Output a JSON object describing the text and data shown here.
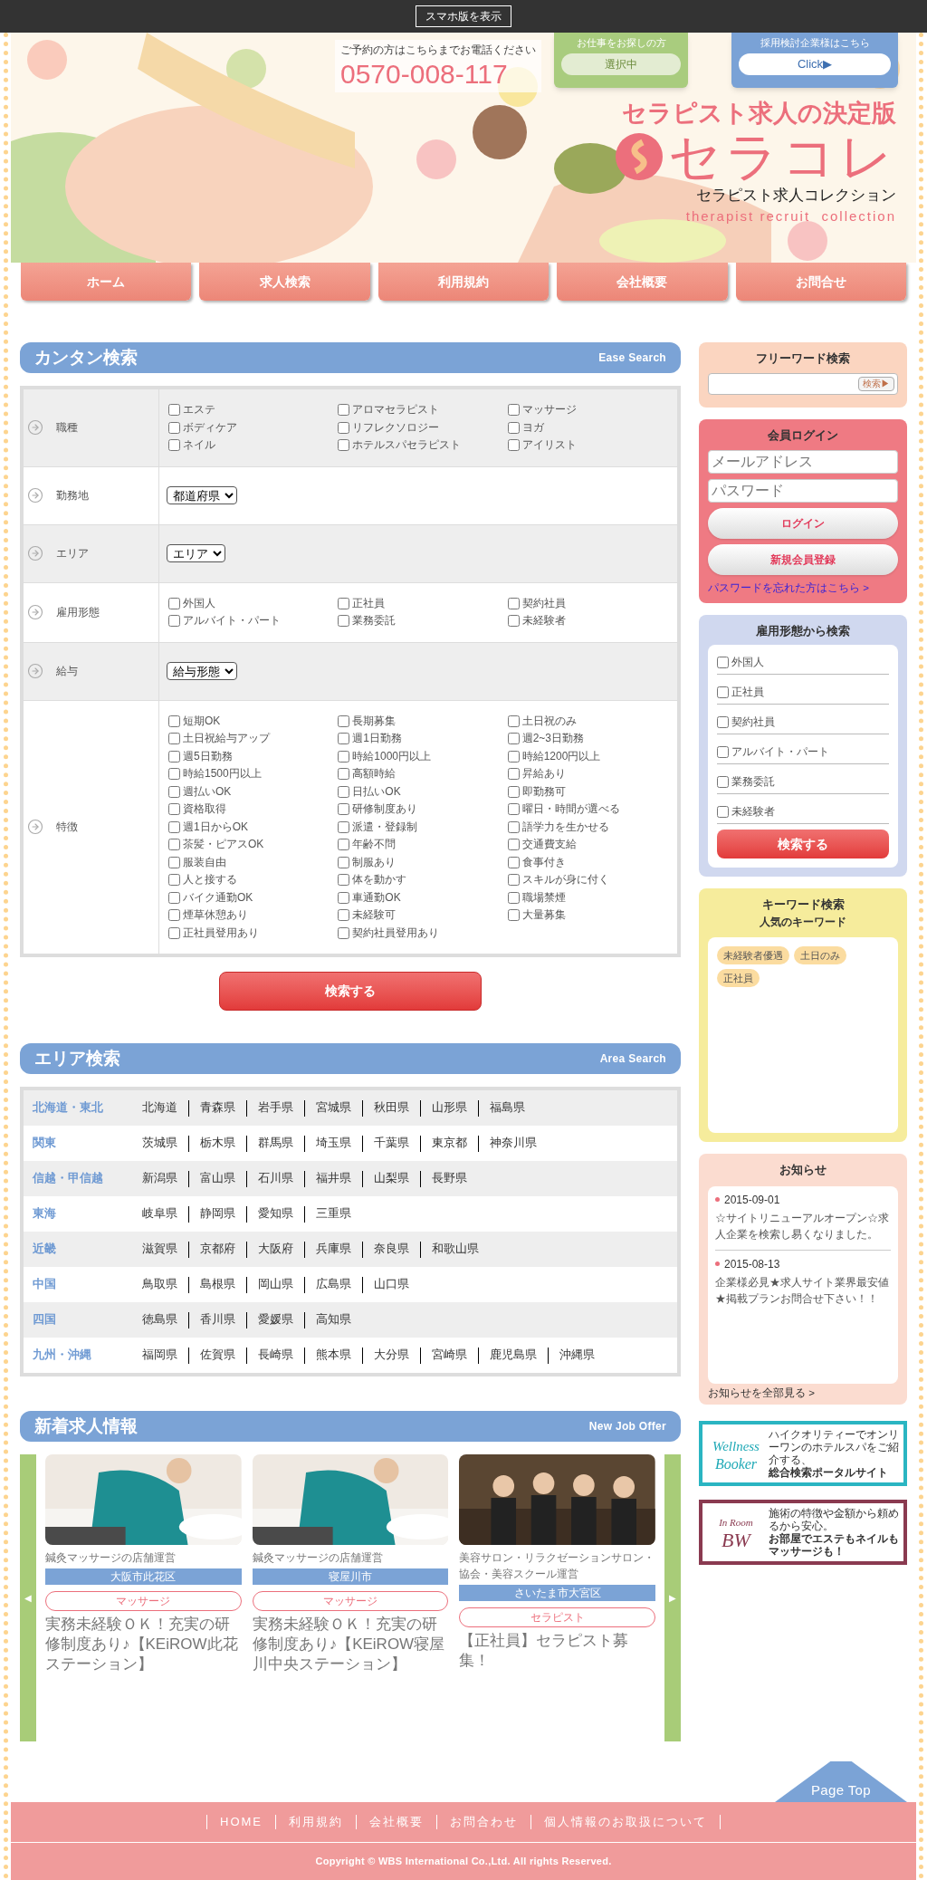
{
  "top_bar": {
    "button": "スマホ版を表示"
  },
  "header": {
    "phone_note": "ご予約の方はこちらまでお電話ください",
    "phone": "0570-008-117",
    "job_seeker": {
      "title": "お仕事をお探しの方",
      "button": "選択中"
    },
    "employer": {
      "title": "採用検討企業様はこちら",
      "button": "Click▶"
    },
    "tagline": "セラピスト求人の決定版",
    "logo": "セラコレ",
    "subtitle": "セラピスト求人コレクション",
    "subtitle_en": "therapist recruit  collection"
  },
  "nav": [
    "ホーム",
    "求人検索",
    "利用規約",
    "会社概要",
    "お問合せ"
  ],
  "easy_search": {
    "title": "カンタン検索",
    "title_en": "Ease Search",
    "rows": [
      {
        "label": "職種",
        "kind": "checkboxes",
        "options": [
          {
            "label": "エステ",
            "checked": false
          },
          {
            "label": "アロマセラピスト",
            "checked": false
          },
          {
            "label": "マッサージ",
            "checked": false
          },
          {
            "label": "ボディケア",
            "checked": false
          },
          {
            "label": "リフレクソロジー",
            "checked": false
          },
          {
            "label": "ヨガ",
            "checked": false
          },
          {
            "label": "ネイル",
            "checked": false
          },
          {
            "label": "ホテルスパセラピスト",
            "checked": false
          },
          {
            "label": "アイリスト",
            "checked": false
          }
        ]
      },
      {
        "label": "勤務地",
        "kind": "select",
        "value": "都道府県"
      },
      {
        "label": "エリア",
        "kind": "select",
        "value": "エリア"
      },
      {
        "label": "雇用形態",
        "kind": "checkboxes",
        "options": [
          {
            "label": "外国人",
            "checked": false
          },
          {
            "label": "正社員",
            "checked": false
          },
          {
            "label": "契約社員",
            "checked": false
          },
          {
            "label": "アルバイト・パート",
            "checked": false
          },
          {
            "label": "業務委託",
            "checked": false
          },
          {
            "label": "未経験者",
            "checked": false
          }
        ]
      },
      {
        "label": "給与",
        "kind": "select",
        "value": "給与形態"
      },
      {
        "label": "特徴",
        "kind": "checkboxes",
        "options": [
          {
            "label": "短期OK",
            "checked": false
          },
          {
            "label": "長期募集",
            "checked": false
          },
          {
            "label": "土日祝のみ",
            "checked": false
          },
          {
            "label": "土日祝給与アップ",
            "checked": false
          },
          {
            "label": "週1日勤務",
            "checked": false
          },
          {
            "label": "週2~3日勤務",
            "checked": false
          },
          {
            "label": "週5日勤務",
            "checked": false
          },
          {
            "label": "時給1000円以上",
            "checked": false
          },
          {
            "label": "時給1200円以上",
            "checked": false
          },
          {
            "label": "時給1500円以上",
            "checked": false
          },
          {
            "label": "高額時給",
            "checked": false
          },
          {
            "label": "昇給あり",
            "checked": false
          },
          {
            "label": "週払いOK",
            "checked": false
          },
          {
            "label": "日払いOK",
            "checked": false
          },
          {
            "label": "即勤務可",
            "checked": false
          },
          {
            "label": "資格取得",
            "checked": false
          },
          {
            "label": "研修制度あり",
            "checked": false
          },
          {
            "label": "曜日・時間が選べる",
            "checked": false
          },
          {
            "label": "週1日からOK",
            "checked": false
          },
          {
            "label": "派遣・登録制",
            "checked": false
          },
          {
            "label": "語学力を生かせる",
            "checked": false
          },
          {
            "label": "茶髪・ピアスOK",
            "checked": false
          },
          {
            "label": "年齢不問",
            "checked": false
          },
          {
            "label": "交通費支給",
            "checked": false
          },
          {
            "label": "服装自由",
            "checked": false
          },
          {
            "label": "制服あり",
            "checked": false
          },
          {
            "label": "食事付き",
            "checked": false
          },
          {
            "label": "人と接する",
            "checked": false
          },
          {
            "label": "体を動かす",
            "checked": false
          },
          {
            "label": "スキルが身に付く",
            "checked": false
          },
          {
            "label": "バイク通勤OK",
            "checked": false
          },
          {
            "label": "車通勤OK",
            "checked": false
          },
          {
            "label": "職場禁煙",
            "checked": false
          },
          {
            "label": "煙草休憩あり",
            "checked": false
          },
          {
            "label": "未経験可",
            "checked": false
          },
          {
            "label": "大量募集",
            "checked": false
          },
          {
            "label": "正社員登用あり",
            "checked": false
          },
          {
            "label": "契約社員登用あり",
            "checked": false
          }
        ]
      }
    ],
    "button": "検索する"
  },
  "area_search": {
    "title": "エリア検索",
    "title_en": "Area Search",
    "rows": [
      {
        "region": "北海道・東北",
        "prefectures": [
          "北海道",
          "青森県",
          "岩手県",
          "宮城県",
          "秋田県",
          "山形県",
          "福島県"
        ]
      },
      {
        "region": "関東",
        "prefectures": [
          "茨城県",
          "栃木県",
          "群馬県",
          "埼玉県",
          "千葉県",
          "東京都",
          "神奈川県"
        ]
      },
      {
        "region": "信越・甲信越",
        "prefectures": [
          "新潟県",
          "富山県",
          "石川県",
          "福井県",
          "山梨県",
          "長野県"
        ]
      },
      {
        "region": "東海",
        "prefectures": [
          "岐阜県",
          "静岡県",
          "愛知県",
          "三重県"
        ]
      },
      {
        "region": "近畿",
        "prefectures": [
          "滋賀県",
          "京都府",
          "大阪府",
          "兵庫県",
          "奈良県",
          "和歌山県"
        ]
      },
      {
        "region": "中国",
        "prefectures": [
          "鳥取県",
          "島根県",
          "岡山県",
          "広島県",
          "山口県"
        ]
      },
      {
        "region": "四国",
        "prefectures": [
          "徳島県",
          "香川県",
          "愛媛県",
          "高知県"
        ]
      },
      {
        "region": "九州・沖縄",
        "prefectures": [
          "福岡県",
          "佐賀県",
          "長崎県",
          "熊本県",
          "大分県",
          "宮崎県",
          "鹿児島県",
          "沖縄県"
        ]
      }
    ]
  },
  "new_jobs": {
    "title": "新着求人情報",
    "title_en": "New Job Offer",
    "prev": "◀",
    "next": "▶",
    "items": [
      {
        "category": "鍼灸マッサージの店舗運営",
        "location": "大阪市此花区",
        "tag": "マッサージ",
        "title": "実務未経験ＯＫ！充実の研修制度あり♪【KEiROW此花ステーション】"
      },
      {
        "category": "鍼灸マッサージの店舗運営",
        "location": "寝屋川市",
        "tag": "マッサージ",
        "title": "実務未経験ＯＫ！充実の研修制度あり♪【KEiROW寝屋川中央ステーション】"
      },
      {
        "category": "美容サロン・リラクゼーションサロン・協会・美容スクール運営",
        "location": "さいたま市大宮区",
        "tag": "セラピスト",
        "title": "【正社員】セラピスト募集！"
      }
    ]
  },
  "free_word": {
    "title": "フリーワード検索",
    "button": "検索▶"
  },
  "login": {
    "title": "会員ログイン",
    "email_placeholder": "メールアドレス",
    "password_placeholder": "パスワード",
    "login_button": "ログイン",
    "register_button": "新規会員登録",
    "forgot_link": "パスワードを忘れた方はこちら >"
  },
  "employment_search": {
    "title": "雇用形態から検索",
    "options": [
      {
        "label": "外国人",
        "checked": false
      },
      {
        "label": "正社員",
        "checked": false
      },
      {
        "label": "契約社員",
        "checked": false
      },
      {
        "label": "アルバイト・パート",
        "checked": false
      },
      {
        "label": "業務委託",
        "checked": false
      },
      {
        "label": "未経験者",
        "checked": false
      }
    ],
    "button": "検索する"
  },
  "keyword_search": {
    "title": "キーワード検索",
    "subtitle": "人気のキーワード",
    "keywords": [
      "未経験者優遇",
      "土日のみ",
      "正社員"
    ]
  },
  "news": {
    "title": "お知らせ",
    "items": [
      {
        "date": "2015-09-01",
        "text": "☆サイトリニューアルオープン☆求人企業を検索し易くなりました。"
      },
      {
        "date": "2015-08-13",
        "text": "企業様必見★求人サイト業界最安値★掲載プランお問合せ下さい！！"
      }
    ],
    "more": "お知らせを全部見る >"
  },
  "banners": [
    {
      "logo_top": "Wellness",
      "logo": "Booker",
      "text": "ハイクオリティーでオンリーワンのホテルスパをご紹介する、",
      "text_bold": "総合検索ポータルサイト"
    },
    {
      "logo_top": "In Room",
      "logo": "BW",
      "text": "施術の特徴や金額から頼めるから安心。",
      "text_bold": "お部屋でエステもネイルもマッサージも！"
    }
  ],
  "page_top": "Page Top",
  "footer": {
    "links": [
      "HOME",
      "利用規約",
      "会社概要",
      "お問合わせ",
      "個人情報のお取扱について"
    ],
    "copyright": "Copyright © WBS International Co.,Ltd. All rights Reserved."
  }
}
